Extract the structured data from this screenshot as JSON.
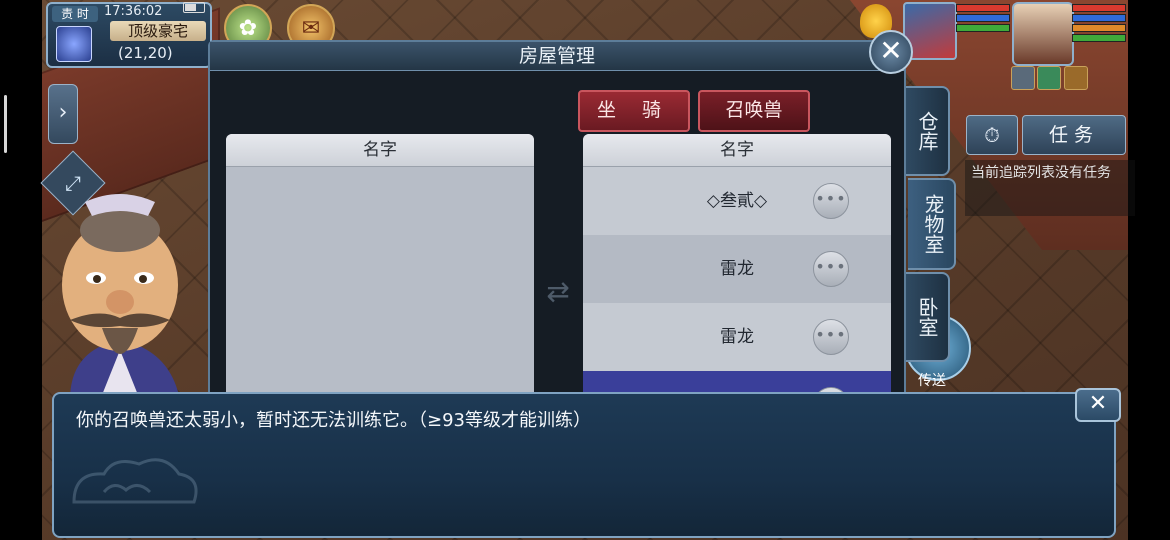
{
  "hud": {
    "badge": "责 时",
    "time": "17:36:02",
    "location_name": "顶级豪宅",
    "coords": "(21,20)"
  },
  "dialog": {
    "title": "房屋管理",
    "tabs": [
      {
        "label": "坐 骑",
        "active": false
      },
      {
        "label": "召唤兽",
        "active": true
      }
    ],
    "left_list": {
      "header": "名字",
      "rows": []
    },
    "right_list": {
      "header": "名字",
      "rows": [
        {
          "name": "◇叁貳◇",
          "more": "•••"
        },
        {
          "name": "雷龙",
          "more": "•••"
        },
        {
          "name": "雷龙",
          "more": "•••"
        },
        {
          "name": "",
          "more": "•••",
          "selected": true
        }
      ]
    },
    "side_tabs": [
      "仓库",
      "宠物室",
      "卧室"
    ]
  },
  "task": {
    "button_label": "任务",
    "empty_text": "当前追踪列表没有任务"
  },
  "teleport_label": "传送",
  "message": "你的召唤兽还太弱小，暂时还无法训练它。（≥93等级才能训练）",
  "colors": {
    "dialog_bg": "#151c24",
    "pill_red": "#9a2a33",
    "selected_row": "#3a3f9a",
    "message_bg": "#1e3a55"
  }
}
